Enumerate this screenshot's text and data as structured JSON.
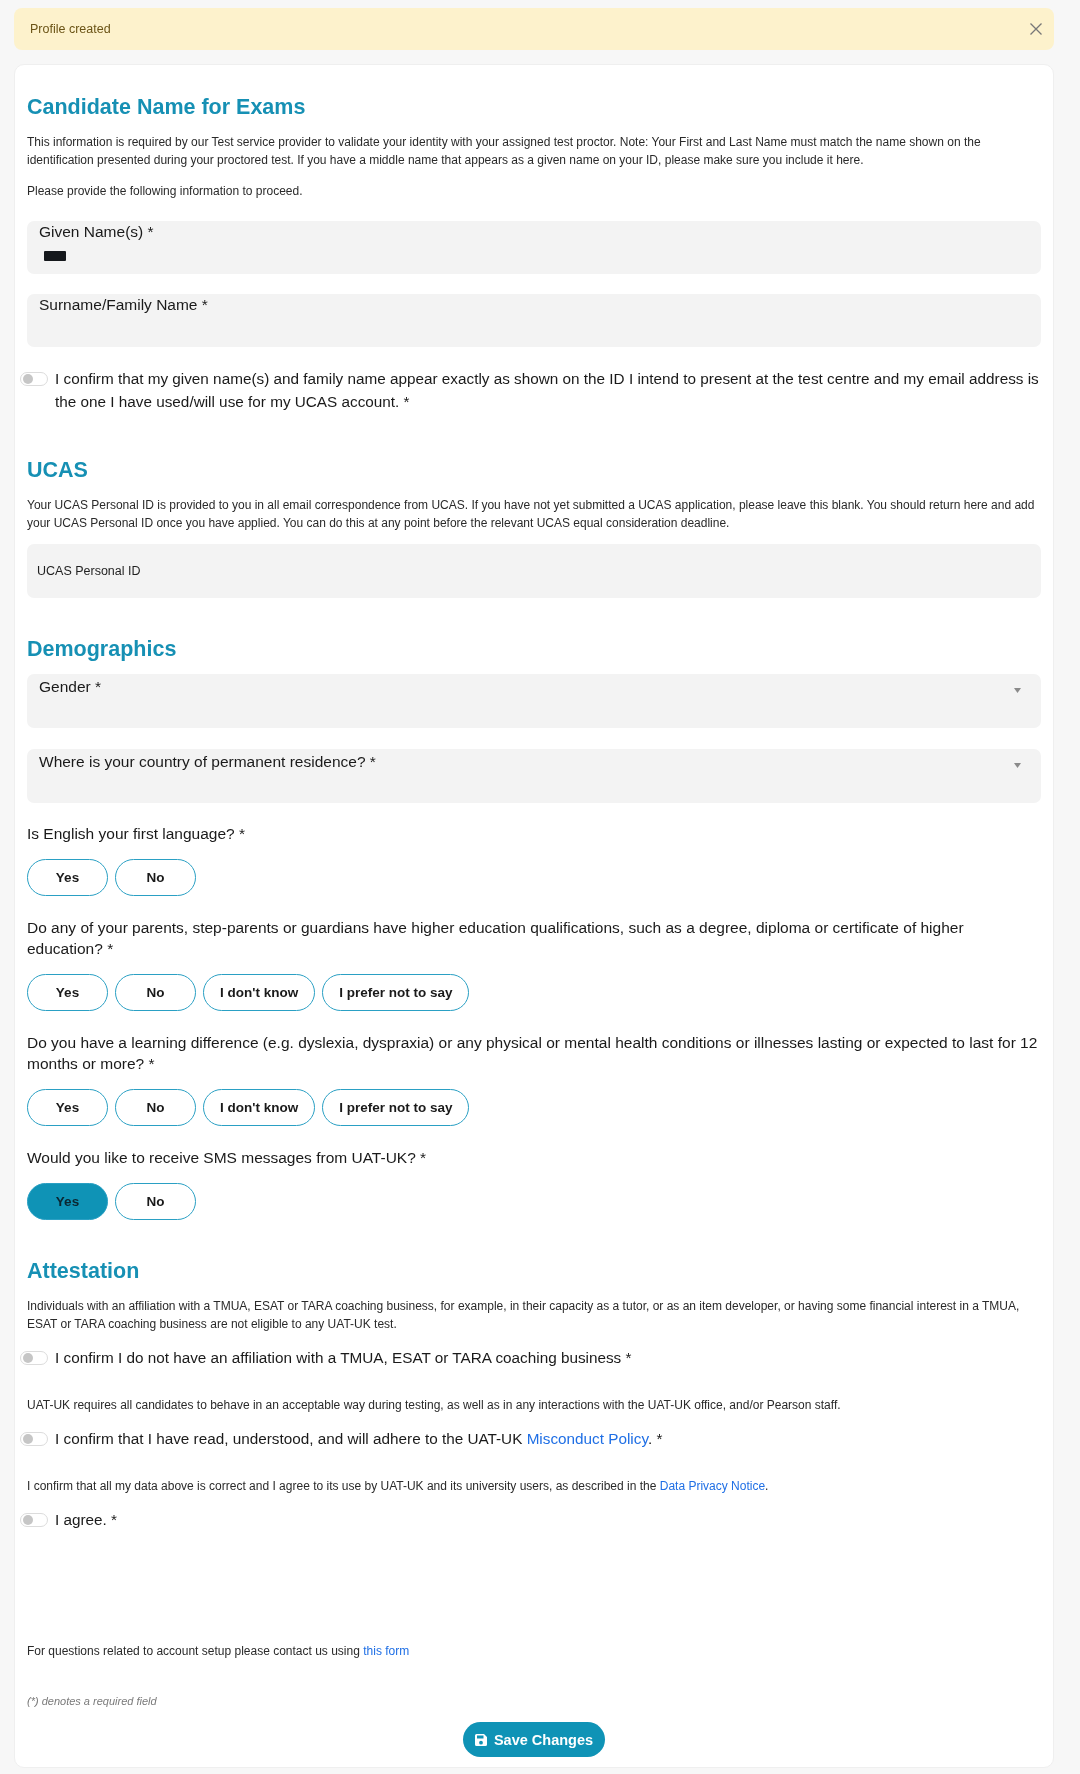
{
  "banner": {
    "message": "Profile created"
  },
  "form": {
    "sections": [
      {
        "title": "Candidate Name for Exams",
        "items": [
          {
            "kind": "paragraph",
            "text": "This information is required by our Test service provider to validate your identity with your assigned test proctor. Note: Your First and Last Name must match the name shown on the identification presented during your proctored test. If you have a middle name that appears as a given name on your ID, please make sure you include it here."
          },
          {
            "kind": "paragraph",
            "text": "Please provide the following information to proceed."
          },
          {
            "kind": "field",
            "label": "Given Name(s) *",
            "redacted": true
          },
          {
            "kind": "field",
            "label": "Surname/Family Name *"
          },
          {
            "kind": "toggle",
            "label": "I confirm that my given name(s) and family name appear exactly as shown on the ID I intend to present at the test centre and my email address is the one I have used/will use for my UCAS account. *",
            "on": false
          }
        ]
      },
      {
        "title": "UCAS",
        "items": [
          {
            "kind": "paragraph",
            "text": "Your UCAS Personal ID is provided to you in all email correspondence from UCAS. If you have not yet submitted a UCAS application, please leave this blank. You should return here and add your UCAS Personal ID once you have applied. You can do this at any point before the relevant UCAS equal consideration deadline."
          },
          {
            "kind": "input",
            "placeholder": "UCAS Personal ID"
          }
        ]
      },
      {
        "title": "Demographics",
        "items": [
          {
            "kind": "select",
            "label": "Gender *"
          },
          {
            "kind": "select",
            "label": "Where is your country of permanent residence? *"
          },
          {
            "kind": "choice",
            "question": "Is English your first language? *",
            "options": [
              {
                "label": "Yes",
                "selected": false
              },
              {
                "label": "No",
                "selected": false
              }
            ]
          },
          {
            "kind": "choice",
            "question": "Do any of your parents, step-parents or guardians have higher education qualifications, such as a degree, diploma or certificate of higher education? *",
            "options": [
              {
                "label": "Yes",
                "selected": false
              },
              {
                "label": "No",
                "selected": false
              },
              {
                "label": "I don't know",
                "selected": false
              },
              {
                "label": "I prefer not to say",
                "selected": false
              }
            ]
          },
          {
            "kind": "choice",
            "question": "Do you have a learning difference (e.g. dyslexia, dyspraxia) or any physical or mental health conditions or illnesses lasting or expected to last for 12 months or more? *",
            "options": [
              {
                "label": "Yes",
                "selected": false
              },
              {
                "label": "No",
                "selected": false
              },
              {
                "label": "I don't know",
                "selected": false
              },
              {
                "label": "I prefer not to say",
                "selected": false
              }
            ]
          },
          {
            "kind": "choice",
            "question": "Would you like to receive SMS messages from UAT-UK? *",
            "options": [
              {
                "label": "Yes",
                "selected": true
              },
              {
                "label": "No",
                "selected": false
              }
            ]
          }
        ]
      },
      {
        "title": "Attestation",
        "items": [
          {
            "kind": "paragraph",
            "text": "Individuals with an affiliation with a TMUA, ESAT or TARA coaching business, for example, in their capacity as a tutor, or as an item developer, or having some financial interest in a TMUA, ESAT or TARA coaching business are not eligible to any UAT-UK test."
          },
          {
            "kind": "toggle",
            "label": "I confirm I do not have an affiliation with a TMUA, ESAT or TARA coaching business *",
            "on": false
          },
          {
            "kind": "paragraph",
            "text": "UAT-UK requires all candidates to behave in an acceptable way during testing, as well as in any interactions with the UAT-UK office, and/or Pearson staff."
          },
          {
            "kind": "toggle",
            "label": "I confirm that I have read, understood, and will adhere to the UAT-UK ",
            "link": "Misconduct Policy",
            "label_end": ". *",
            "on": false
          },
          {
            "kind": "paragraph",
            "text": "I confirm that all my data above is correct and I agree to its use by UAT-UK and its university users, as described in the ",
            "link": "Data Privacy Notice",
            "text_end": "."
          },
          {
            "kind": "toggle",
            "label": "I agree. *",
            "on": false
          }
        ]
      }
    ],
    "contact": {
      "text": "For questions related to account setup please contact us using ",
      "link": "this form"
    },
    "footnote": "(*) denotes a required field",
    "save_button": {
      "label": "Save Changes"
    }
  }
}
